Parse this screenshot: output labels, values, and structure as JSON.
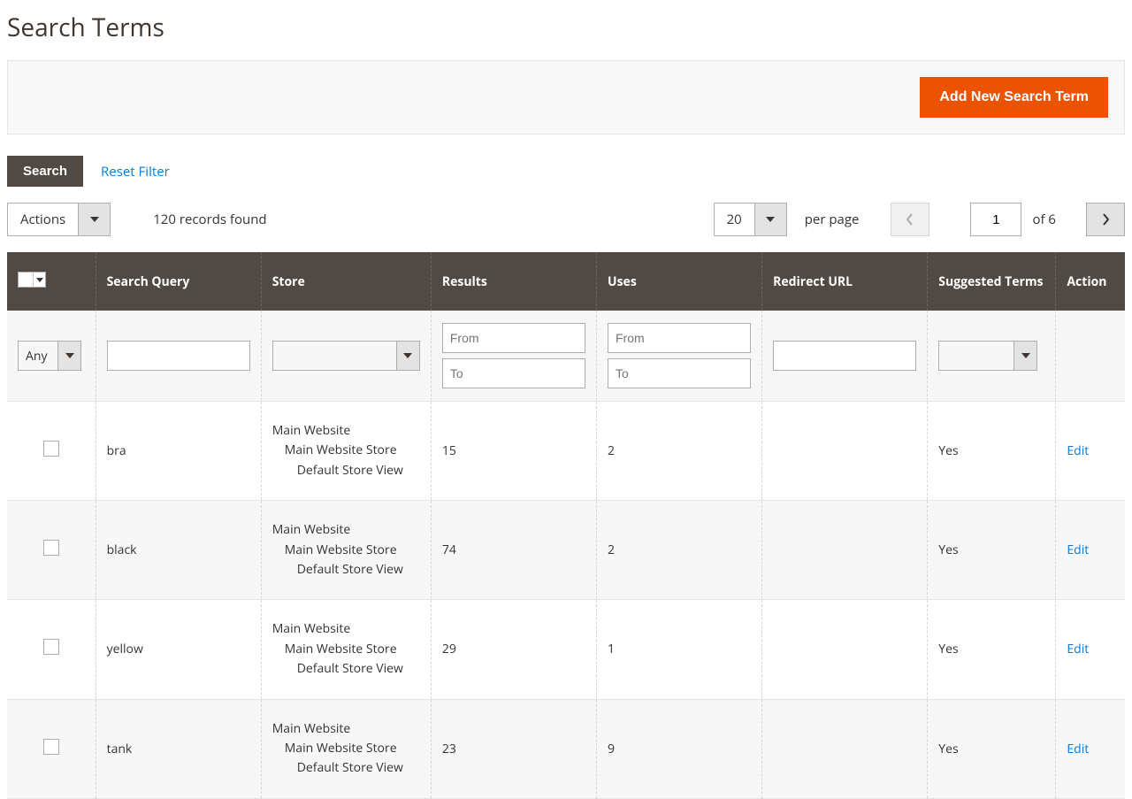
{
  "page": {
    "title": "Search Terms"
  },
  "topbar": {
    "add_button": "Add New Search Term"
  },
  "toolbar": {
    "search_button": "Search",
    "reset_filter": "Reset Filter",
    "actions_label": "Actions",
    "records_found": "120 records found",
    "per_page_value": "20",
    "per_page_text": "per page",
    "page_current": "1",
    "page_of": "of 6"
  },
  "columns": {
    "search_query": "Search Query",
    "store": "Store",
    "results": "Results",
    "uses": "Uses",
    "redirect_url": "Redirect URL",
    "suggested_terms": "Suggested Terms",
    "action": "Action"
  },
  "filters": {
    "any_label": "Any",
    "from_placeholder": "From",
    "to_placeholder": "To"
  },
  "rows": [
    {
      "query": "bra",
      "store_l1": "Main Website",
      "store_l2": "Main Website Store",
      "store_l3": "Default Store View",
      "results": "15",
      "uses": "2",
      "redirect": "",
      "suggested": "Yes",
      "action": "Edit"
    },
    {
      "query": "black",
      "store_l1": "Main Website",
      "store_l2": "Main Website Store",
      "store_l3": "Default Store View",
      "results": "74",
      "uses": "2",
      "redirect": "",
      "suggested": "Yes",
      "action": "Edit"
    },
    {
      "query": "yellow",
      "store_l1": "Main Website",
      "store_l2": "Main Website Store",
      "store_l3": "Default Store View",
      "results": "29",
      "uses": "1",
      "redirect": "",
      "suggested": "Yes",
      "action": "Edit"
    },
    {
      "query": "tank",
      "store_l1": "Main Website",
      "store_l2": "Main Website Store",
      "store_l3": "Default Store View",
      "results": "23",
      "uses": "9",
      "redirect": "",
      "suggested": "Yes",
      "action": "Edit"
    }
  ]
}
